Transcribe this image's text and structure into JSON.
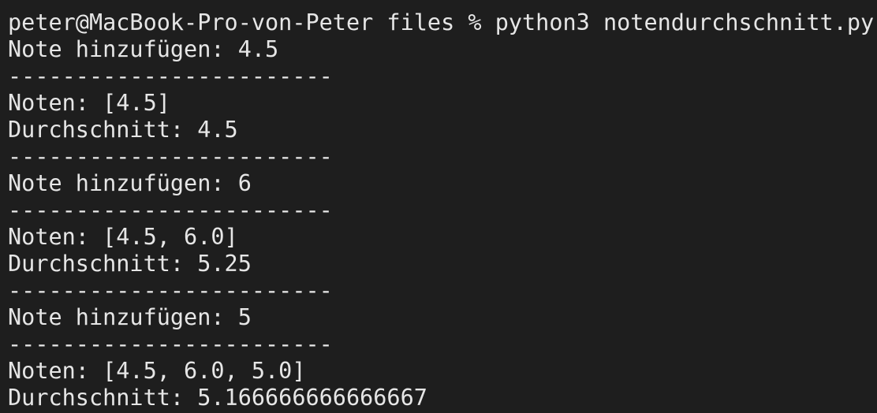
{
  "terminal": {
    "lines": [
      "peter@MacBook-Pro-von-Peter files % python3 notendurchschnitt.py",
      "Note hinzufügen: 4.5",
      "------------------------",
      "Noten: [4.5]",
      "Durchschnitt: 4.5",
      "------------------------",
      "Note hinzufügen: 6",
      "------------------------",
      "Noten: [4.5, 6.0]",
      "Durchschnitt: 5.25",
      "------------------------",
      "Note hinzufügen: 5",
      "------------------------",
      "Noten: [4.5, 6.0, 5.0]",
      "Durchschnitt: 5.166666666666667"
    ]
  },
  "colors": {
    "background": "#1e1e1e",
    "text": "#e6e6e6"
  }
}
